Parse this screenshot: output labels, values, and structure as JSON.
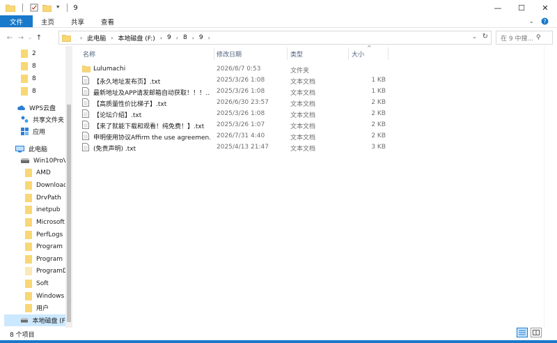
{
  "window": {
    "title": "9",
    "controls": {
      "minimize": "—",
      "maximize": "☐",
      "close": "✕"
    }
  },
  "ribbon": {
    "tabs": [
      {
        "label": "文件",
        "active": true
      },
      {
        "label": "主页",
        "active": false
      },
      {
        "label": "共享",
        "active": false
      },
      {
        "label": "查看",
        "active": false
      }
    ],
    "expand_icon": "chevron-down-icon",
    "help_icon": "help-icon"
  },
  "address": {
    "crumbs": [
      "此电脑",
      "本地磁盘 (F:)",
      "9",
      "8",
      "9"
    ]
  },
  "search": {
    "placeholder": "在 9 中搜..."
  },
  "sidebar": {
    "items": [
      {
        "label": "2",
        "icon": "folder-icon"
      },
      {
        "label": "8",
        "icon": "folder-icon"
      },
      {
        "label": "8",
        "icon": "folder-icon"
      },
      {
        "label": "8",
        "icon": "folder-icon"
      },
      {
        "label": "WPS云盘",
        "icon": "cloud-icon"
      },
      {
        "label": "共享文件夹",
        "icon": "share-icon"
      },
      {
        "label": "应用",
        "icon": "apps-icon"
      },
      {
        "label": "此电脑",
        "icon": "computer-icon"
      },
      {
        "label": "Win10ProV",
        "icon": "drive-icon"
      },
      {
        "label": "AMD",
        "icon": "folder-icon"
      },
      {
        "label": "Download",
        "icon": "folder-icon"
      },
      {
        "label": "DrvPath",
        "icon": "folder-icon"
      },
      {
        "label": "inetpub",
        "icon": "folder-icon"
      },
      {
        "label": "Microsoft",
        "icon": "folder-icon"
      },
      {
        "label": "PerfLogs",
        "icon": "folder-icon"
      },
      {
        "label": "Program",
        "icon": "folder-icon"
      },
      {
        "label": "Program",
        "icon": "folder-icon"
      },
      {
        "label": "ProgramD",
        "icon": "folder-icon"
      },
      {
        "label": "Soft",
        "icon": "folder-icon"
      },
      {
        "label": "Windows",
        "icon": "folder-icon"
      },
      {
        "label": "用户",
        "icon": "folder-icon"
      },
      {
        "label": "本地磁盘 (F",
        "icon": "drive-icon"
      }
    ]
  },
  "columns": {
    "name": "名称",
    "date": "修改日期",
    "type": "类型",
    "size": "大小"
  },
  "files": [
    {
      "name": "Lulumachi",
      "date": "2026/8/7 0:53",
      "type": "文件夹",
      "size": "",
      "icon": "folder-icon"
    },
    {
      "name": "【永久地址发布页】.txt",
      "date": "2025/3/26 1:08",
      "type": "文本文档",
      "size": "1 KB",
      "icon": "text-file-icon"
    },
    {
      "name": "最新地址及APP请发邮箱自动获取！！！...",
      "date": "2025/3/26 1:08",
      "type": "文本文档",
      "size": "1 KB",
      "icon": "text-file-icon"
    },
    {
      "name": "【高质量性价比梯子】.txt",
      "date": "2026/6/30 23:57",
      "type": "文本文档",
      "size": "2 KB",
      "icon": "text-file-icon"
    },
    {
      "name": "【论坛介绍】.txt",
      "date": "2025/3/26 1:08",
      "type": "文本文档",
      "size": "2 KB",
      "icon": "text-file-icon"
    },
    {
      "name": "【来了就能下载和观看！纯免费！】.txt",
      "date": "2025/3/26 1:07",
      "type": "文本文档",
      "size": "2 KB",
      "icon": "text-file-icon"
    },
    {
      "name": "申明使用协议Affirm the use agreemen...",
      "date": "2026/7/31 4:40",
      "type": "文本文档",
      "size": "2 KB",
      "icon": "text-file-icon"
    },
    {
      "name": "(免责声明) .txt",
      "date": "2025/4/13 21:47",
      "type": "文本文档",
      "size": "3 KB",
      "icon": "text-file-icon"
    }
  ],
  "status": {
    "count": "8 个项目"
  },
  "colors": {
    "accent": "#1979ca",
    "folder": "#f8d775",
    "selection": "#cce8ff"
  }
}
